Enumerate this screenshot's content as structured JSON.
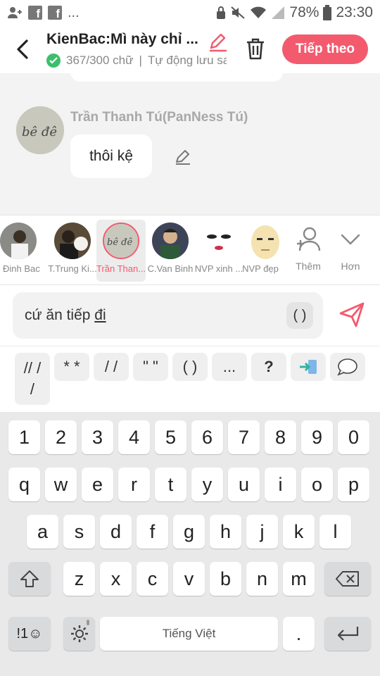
{
  "status_bar": {
    "battery": "78%",
    "time": "23:30",
    "dots": "...",
    "fb_label": "f"
  },
  "header": {
    "title": "KienBac:Mì này chỉ ...",
    "word_count": "367/300 chữ",
    "autosave": "Tự động lưu sau",
    "next_label": "Tiếp theo"
  },
  "chat": {
    "sender_name": "Trần Thanh Tú(PanNess Tú)",
    "message": "thôi kệ",
    "avatar_text": "bê đê"
  },
  "characters": [
    {
      "name": "Đinh Bac"
    },
    {
      "name": "T.Trung Ki..."
    },
    {
      "name": "Trần Than...",
      "selected": true,
      "avatar_text": "bê đê"
    },
    {
      "name": "C.Van Binh"
    },
    {
      "name": "NVP xinh ..."
    },
    {
      "name": "NVP đẹp"
    }
  ],
  "actions": {
    "add_label": "Thêm",
    "more_label": "Hơn"
  },
  "input": {
    "text_before": "cứ ăn tiếp ",
    "text_underlined": "đi",
    "paren_label": "( )"
  },
  "quick_symbols": [
    "// /\n/",
    "* *",
    "/ /",
    "\" \"",
    "( )",
    "...",
    "?"
  ],
  "keyboard": {
    "row_numbers": [
      "1",
      "2",
      "3",
      "4",
      "5",
      "6",
      "7",
      "8",
      "9",
      "0"
    ],
    "row1": [
      "q",
      "w",
      "e",
      "r",
      "t",
      "y",
      "u",
      "i",
      "o",
      "p"
    ],
    "row2": [
      "a",
      "s",
      "d",
      "f",
      "g",
      "h",
      "j",
      "k",
      "l"
    ],
    "row3": [
      "z",
      "x",
      "c",
      "v",
      "b",
      "n",
      "m"
    ],
    "symbols_label": "!1☺",
    "space_label": "Tiếng Việt",
    "period_label": "."
  },
  "colors": {
    "accent": "#f35a6e",
    "check_green": "#3cbf6a"
  }
}
